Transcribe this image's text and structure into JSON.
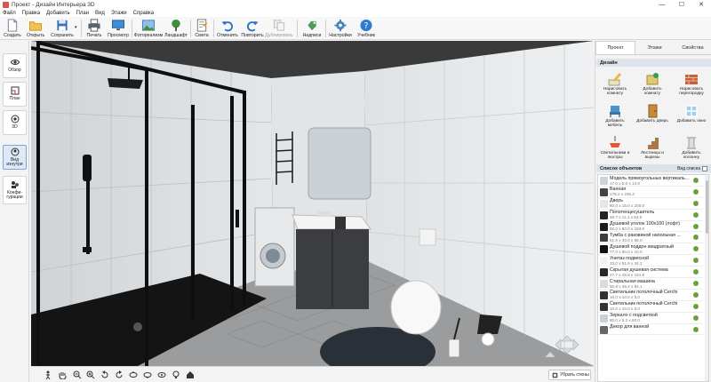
{
  "window": {
    "title": "Проект - Дизайн Интерьера 3D",
    "minimize": "—",
    "maximize": "☐",
    "close": "✕"
  },
  "menu": [
    "Файл",
    "Правка",
    "Добавить",
    "План",
    "Вид",
    "Этажи",
    "Справка"
  ],
  "toolbar": {
    "create": "Создать",
    "open": "Открыть",
    "save": "Сохранить",
    "print": "Печать",
    "preview": "Просмотр",
    "photorealism": "Фотореализм",
    "landscape": "Ландшафт",
    "estimate": "Смета",
    "undo": "Отменить",
    "redo": "Повторить",
    "duplicate": "Дублировать",
    "labels": "Надписи",
    "settings": "Настройки",
    "tutorial": "Учебник"
  },
  "leftrail": {
    "overview": "Обзор",
    "plan": "План",
    "view3d": "3D",
    "interior_view": "Вид изнутри",
    "configurations": "Конфи-гурации"
  },
  "viewbar": {
    "hide_walls": "Убрать стены"
  },
  "panel": {
    "tabs": [
      "Проект",
      "Этажи",
      "Свойства"
    ],
    "design_title": "Дизайн",
    "design_buttons": [
      "Нарисовать комнату",
      "Добавить комнату",
      "Нарисовать перегородку",
      "Добавить мебель",
      "Добавить дверь",
      "Добавить окно",
      "Светильники и люстры",
      "Лестницы и вырезы",
      "Добавить колонну"
    ],
    "objects_title": "Список объектов",
    "view_list": "Вид списка",
    "objects": [
      {
        "name": "Модель прямоугольных вертикаль...",
        "size": "17.0 x 5.0 x 14.0"
      },
      {
        "name": "Ванная",
        "size": "178.2 x 235.4"
      },
      {
        "name": "Дверь",
        "size": "80.0 x 15.0 x 200.0"
      },
      {
        "name": "Полотенцесушитель",
        "size": "46.7 x 11.1 x 64.9"
      },
      {
        "name": "Душевой уголок 100х100 (лофт)",
        "size": "92.0 x 90.0 x 193.0"
      },
      {
        "name": "Тумба с раковиной напольная ...",
        "size": "51.6 x 40.0 x 85.0"
      },
      {
        "name": "Душевой поддон квадратный",
        "size": "77.0 x 90.0 x 10.0"
      },
      {
        "name": "Унитаз подвесной",
        "size": "33.0 x 51.9 x 34.2"
      },
      {
        "name": "Скрытая душевая система",
        "size": "47.7 x 45.6 x 151.8"
      },
      {
        "name": "Стиральная машина",
        "size": "50.8 x 46.4 x 84.1"
      },
      {
        "name": "Светильник потолочный Cerchi",
        "size": "10.0 x 10.0 x 5.0"
      },
      {
        "name": "Светильник потолочный Cerchi",
        "size": "10.0 x 10.0 x 5.0"
      },
      {
        "name": "Зеркало с подсветкой",
        "size": "80.0 x 5.2 x 80.0"
      },
      {
        "name": "Декор для ванной",
        "size": ""
      }
    ]
  },
  "colors": {
    "accent": "#3a78c4",
    "visible": "#6aa13d",
    "frame": "#151515"
  }
}
